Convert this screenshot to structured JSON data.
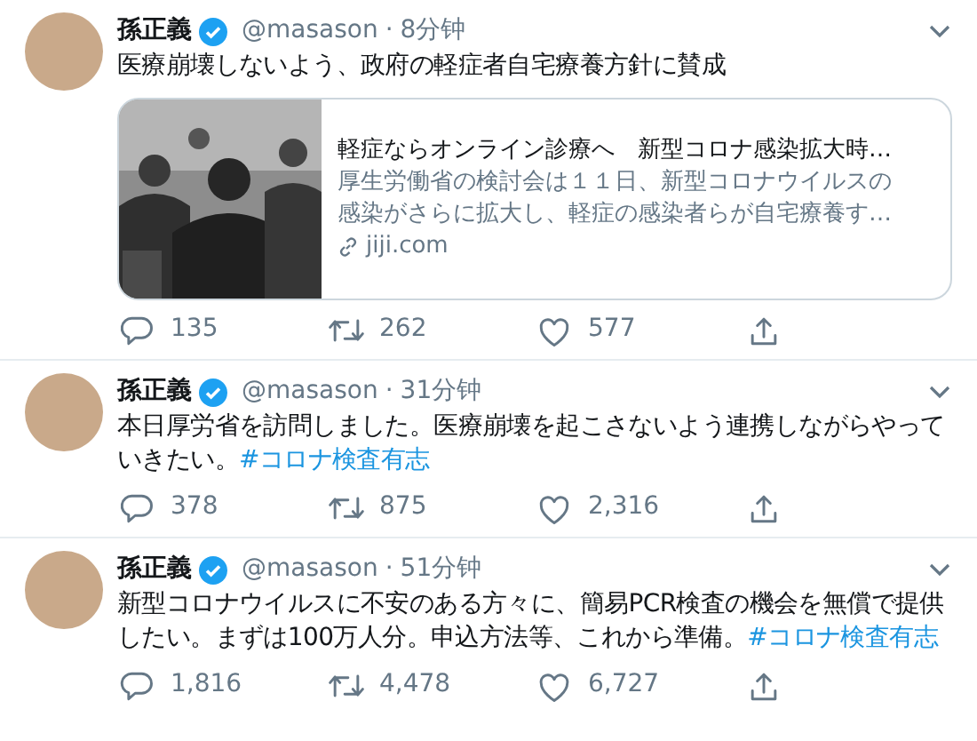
{
  "tweets": [
    {
      "name": "孫正義",
      "verified": true,
      "handle": "@masason",
      "separator": "·",
      "time": "8分钟",
      "text": "医療崩壊しないよう、政府の軽症者自宅療養方針に賛成",
      "card": {
        "image": {
          "kind": "picture"
        },
        "title": "軽症ならオンライン診療へ　新型コロナ感染拡大時…",
        "description": [
          "厚生労働省の検討会は１１日、新型コロナウイルスの",
          "感染がさらに拡大し、軽症の感染者らが自宅療養す…"
        ],
        "domain": "jiji.com"
      },
      "replies": "135",
      "retweets": "262",
      "likes": "577"
    },
    {
      "name": "孫正義",
      "verified": true,
      "handle": "@masason",
      "separator": "·",
      "time": "31分钟",
      "text": "本日厚労省を訪問しました。医療崩壊を起こさないよう連携しながらやっていきたい。",
      "hashtag": "#コロナ検査有志",
      "replies": "378",
      "retweets": "875",
      "likes": "2,316"
    },
    {
      "name": "孫正義",
      "verified": true,
      "handle": "@masason",
      "separator": "·",
      "time": "51分钟",
      "text": "新型コロナウイルスに不安のある方々に、簡易PCR検査の機会を無償で提供したい。まずは100万人分。申込方法等、これから準備。",
      "hashtag": "#コロナ検査有志",
      "replies": "1,816",
      "retweets": "4,478",
      "likes": "6,727"
    }
  ]
}
